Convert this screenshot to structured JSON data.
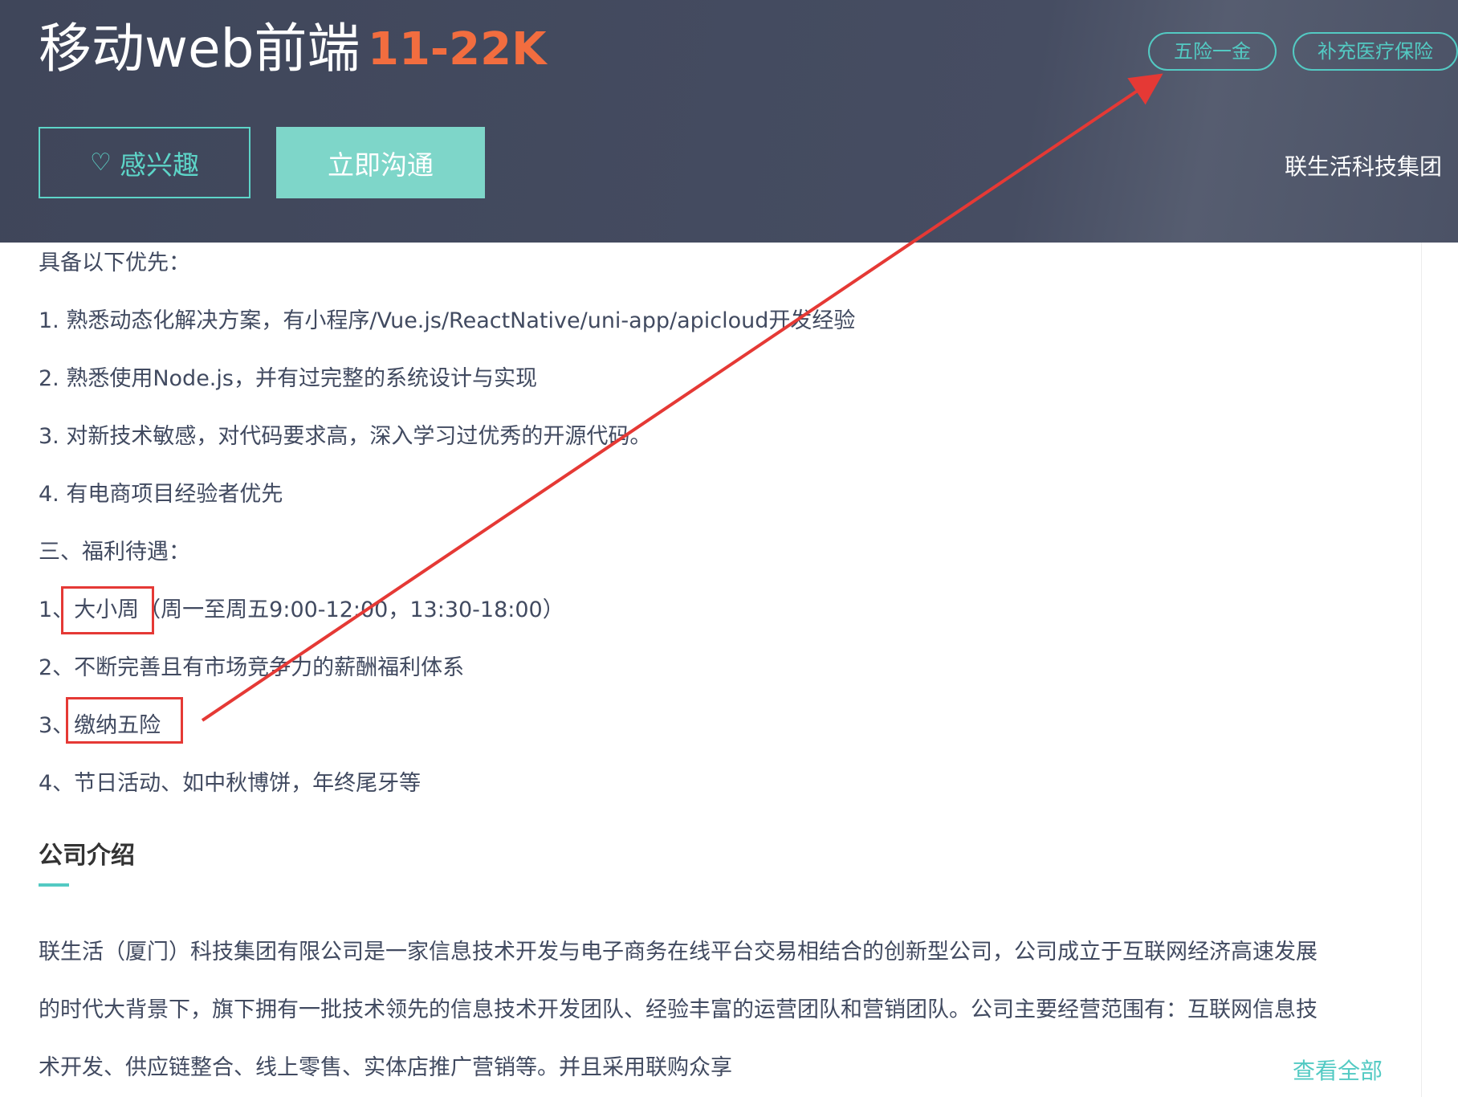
{
  "header": {
    "job_title": "移动web前端",
    "salary": "11-22K",
    "tags": [
      "五险一金",
      "补充医疗保险"
    ],
    "interest_label": "感兴趣",
    "chat_label": "立即沟通",
    "company_name": "联生活科技集团"
  },
  "requirements": {
    "heading": "具备以下优先：",
    "items": [
      "1. 熟悉动态化解决方案，有小程序/Vue.js/ReactNative/uni-app/apicloud开发经验",
      "2. 熟悉使用Node.js，并有过完整的系统设计与实现",
      "3. 对新技术敏感，对代码要求高，深入学习过优秀的开源代码。",
      "4. 有电商项目经验者优先"
    ]
  },
  "benefits": {
    "heading": "三、福利待遇：",
    "items": [
      "1、大小周（周一至周五9:00-12:00，13:30-18:00）",
      "2、不断完善且有市场竞争力的薪酬福利体系",
      "3、缴纳五险",
      "4、节日活动、如中秋博饼，年终尾牙等"
    ]
  },
  "company_intro": {
    "title": "公司介绍",
    "lines": [
      "联生活（厦门）科技集团有限公司是一家信息技术开发与电子商务在线平台交易相结合的创新型公司，公司成立于互联网经济高速发展",
      "的时代大背景下，旗下拥有一批技术领先的信息技术开发团队、经验丰富的运营团队和营销团队。公司主要经营范围有：互联网信息技",
      "术开发、供应链整合、线上零售、实体店推广营销等。并且采用联购众享"
    ],
    "view_all": "查看全部"
  },
  "colors": {
    "header_bg": "#454c61",
    "accent": "#53cac3",
    "salary": "#f26d3f",
    "annotation": "#e53935"
  },
  "icons": [
    "heart-icon"
  ]
}
